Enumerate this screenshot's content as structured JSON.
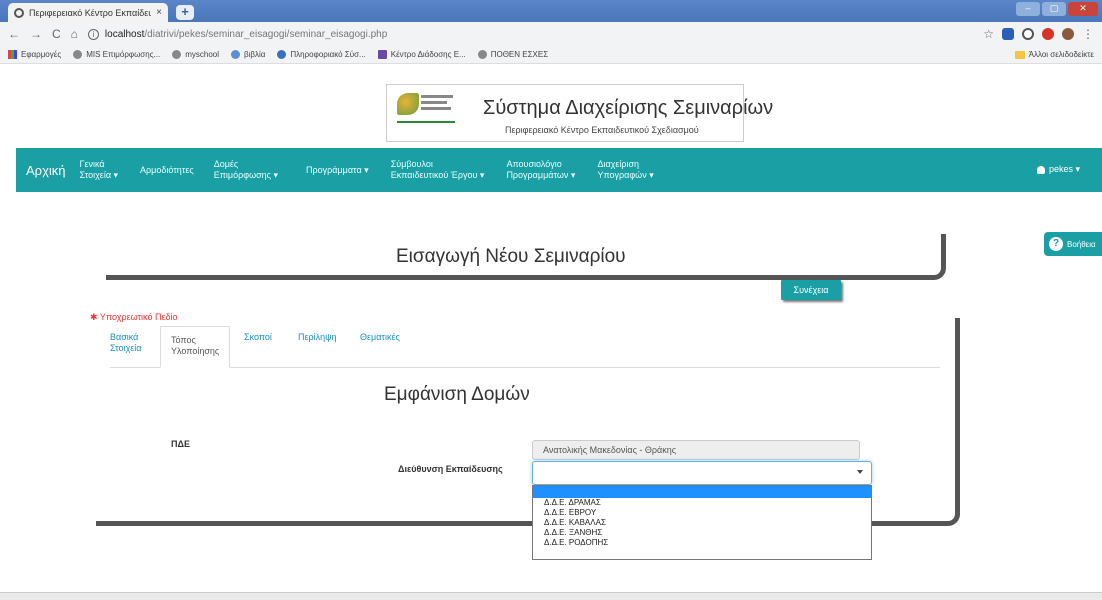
{
  "browser": {
    "tab_title": "Περιφερειακό Κέντρο Εκπαίδευ",
    "tab_close": "×",
    "new_tab": "+",
    "url_host": "localhost",
    "url_path": "/diatrivi/pekes/seminar_eisagogi/seminar_eisagogi.php",
    "info": "i",
    "back": "←",
    "forward": "→",
    "reload": "C",
    "home": "⌂",
    "star": "☆",
    "menu": "⋮",
    "win_min": "–",
    "win_max": "▢",
    "win_close": "✕",
    "bookmarks": [
      "Εφαρμογές",
      "MIS Επιμόρφωσης...",
      "myschool",
      "βιβλία",
      "Πληροφοριακό Σύσ...",
      "Κέντρο Διάδοσης Ε...",
      "ΠΟΘΕΝ ΕΣΧΕΣ"
    ],
    "other_bookmarks": "Άλλοι σελιδοδείκτε"
  },
  "header": {
    "system_title": "Σύστημα Διαχείρισης Σεμιναρίων",
    "system_subtitle": "Περιφερειακό Κέντρο Εκπαιδευτικού Σχεδιασμού"
  },
  "navbar": {
    "brand": "Αρχική",
    "items": [
      {
        "line1": "Γενικά",
        "line2": "Στοιχεία ▾"
      },
      {
        "line1": "Αρμοδιότητες",
        "line2": ""
      },
      {
        "line1": "Δομές",
        "line2": "Επιμόρφωσης ▾"
      },
      {
        "line1": "Προγράμματα ▾",
        "line2": ""
      },
      {
        "line1": "Σύμβουλοι",
        "line2": "Εκπαιδευτικού Έργου ▾"
      },
      {
        "line1": "Απουσιολόγιο",
        "line2": "Προγραμμάτων ▾"
      },
      {
        "line1": "Διαχείριση",
        "line2": "Υπογραφών ▾"
      }
    ],
    "user": "pekes ▾"
  },
  "help_button": {
    "label": "Βοήθεια",
    "icon": "?"
  },
  "page": {
    "title": "Εισαγωγή Νέου Σεμιναρίου",
    "continue_label": "Συνέχεια",
    "required_note": "Υποχρεωτικό Πεδίο",
    "required_star": "✱"
  },
  "tabs": [
    {
      "line1": "Βασικά",
      "line2": "Στοιχεία"
    },
    {
      "line1": "Τόπος",
      "line2": "Υλοποίησης"
    },
    {
      "line1": "Σκοποί",
      "line2": ""
    },
    {
      "line1": "Περίληψη",
      "line2": ""
    },
    {
      "line1": "Θεματικές",
      "line2": ""
    }
  ],
  "section": {
    "title": "Εμφάνιση Δομών"
  },
  "form": {
    "pde_label": "ΠΔΕ",
    "pde_value": "Ανατολικής Μακεδονίας - Θράκης",
    "direction_label": "Διεύθυνση Εκπαίδευσης",
    "direction_value": "",
    "options": [
      "Δ.Δ.Ε. ΔΡΑΜΑΣ",
      "Δ.Δ.Ε. ΕΒΡΟΥ",
      "Δ.Δ.Ε. ΚΑΒΑΛΑΣ",
      "Δ.Δ.Ε. ΞΑΝΘΗΣ",
      "Δ.Δ.Ε. ΡΟΔΟΠΗΣ"
    ]
  },
  "colors": {
    "accent": "#1aa0a4",
    "required": "#ee3333",
    "highlight": "#1e90ff"
  }
}
